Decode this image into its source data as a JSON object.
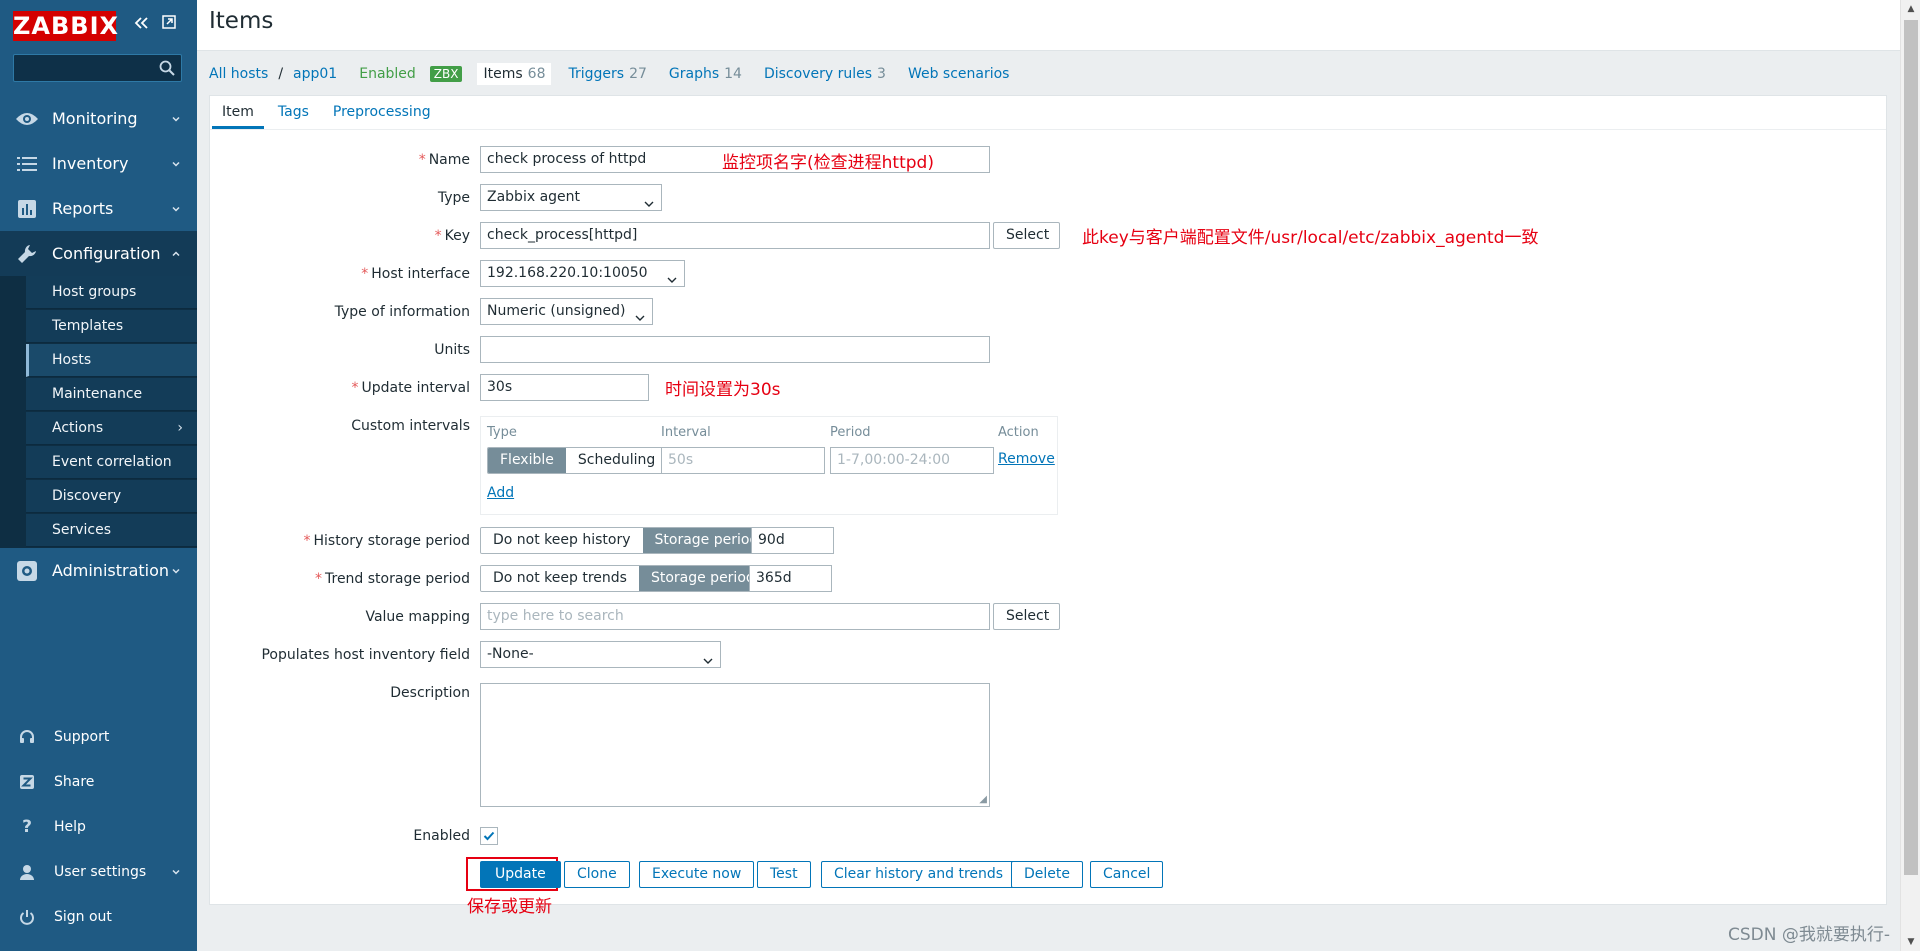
{
  "app": {
    "logo": "ZABBIX",
    "page_title": "Items"
  },
  "sidebar": {
    "search_placeholder": "",
    "menus": [
      {
        "label": "Monitoring",
        "icon": "eye-icon"
      },
      {
        "label": "Inventory",
        "icon": "list-icon"
      },
      {
        "label": "Reports",
        "icon": "bar-chart-icon"
      },
      {
        "label": "Configuration",
        "icon": "wrench-icon"
      },
      {
        "label": "Administration",
        "icon": "gear-icon"
      }
    ],
    "config_items": [
      {
        "label": "Host groups"
      },
      {
        "label": "Templates"
      },
      {
        "label": "Hosts"
      },
      {
        "label": "Maintenance"
      },
      {
        "label": "Actions"
      },
      {
        "label": "Event correlation"
      },
      {
        "label": "Discovery"
      },
      {
        "label": "Services"
      }
    ],
    "bottom": [
      {
        "label": "Support",
        "icon": "headset-icon"
      },
      {
        "label": "Share",
        "icon": "share-icon"
      },
      {
        "label": "Help",
        "icon": "help-icon"
      },
      {
        "label": "User settings",
        "icon": "user-icon"
      },
      {
        "label": "Sign out",
        "icon": "power-icon"
      }
    ]
  },
  "breadcrumb": {
    "all_hosts": "All hosts",
    "separator": "/",
    "host": "app01",
    "status": "Enabled",
    "zbx": "ZBX",
    "tabs": [
      {
        "label": "Items",
        "count": "68"
      },
      {
        "label": "Triggers",
        "count": "27"
      },
      {
        "label": "Graphs",
        "count": "14"
      },
      {
        "label": "Discovery rules",
        "count": "3"
      },
      {
        "label": "Web scenarios",
        "count": ""
      }
    ]
  },
  "form_tabs": [
    "Item",
    "Tags",
    "Preprocessing"
  ],
  "form": {
    "name": {
      "label": "Name",
      "value": "check  process of httpd"
    },
    "type": {
      "label": "Type",
      "value": "Zabbix agent"
    },
    "key": {
      "label": "Key",
      "value": "check_process[httpd]",
      "button": "Select"
    },
    "host_interface": {
      "label": "Host interface",
      "value": "192.168.220.10:10050"
    },
    "type_of_information": {
      "label": "Type of information",
      "value": "Numeric (unsigned)"
    },
    "units": {
      "label": "Units",
      "value": ""
    },
    "update_interval": {
      "label": "Update interval",
      "value": "30s"
    },
    "custom_intervals": {
      "label": "Custom intervals",
      "headers": [
        "Type",
        "Interval",
        "Period",
        "Action"
      ],
      "type_options": [
        "Flexible",
        "Scheduling"
      ],
      "interval_placeholder": "50s",
      "period_placeholder": "1-7,00:00-24:00",
      "remove": "Remove",
      "add": "Add"
    },
    "history": {
      "label": "History storage period",
      "options": [
        "Do not keep history",
        "Storage period"
      ],
      "value": "90d"
    },
    "trend": {
      "label": "Trend storage period",
      "options": [
        "Do not keep trends",
        "Storage period"
      ],
      "value": "365d"
    },
    "value_mapping": {
      "label": "Value mapping",
      "placeholder": "type here to search",
      "button": "Select"
    },
    "inventory": {
      "label": "Populates host inventory field",
      "value": "-None-"
    },
    "description": {
      "label": "Description",
      "value": ""
    },
    "enabled": {
      "label": "Enabled",
      "checked": true
    }
  },
  "buttons": {
    "update": "Update",
    "clone": "Clone",
    "execute": "Execute now",
    "test": "Test",
    "clear": "Clear history and trends",
    "delete": "Delete",
    "cancel": "Cancel"
  },
  "annotations": {
    "name_note": "监控项名字(检查进程httpd)",
    "key_note": "此key与客户端配置文件/usr/local/etc/zabbix_agentd一致",
    "interval_note": "时间设置为30s",
    "update_note": "保存或更新"
  },
  "watermark": "CSDN @我就要执行-",
  "colors": {
    "sidebar": "#1f5a83",
    "link": "#0275b8",
    "annotation": "#e60012",
    "enabled": "#429e47"
  }
}
